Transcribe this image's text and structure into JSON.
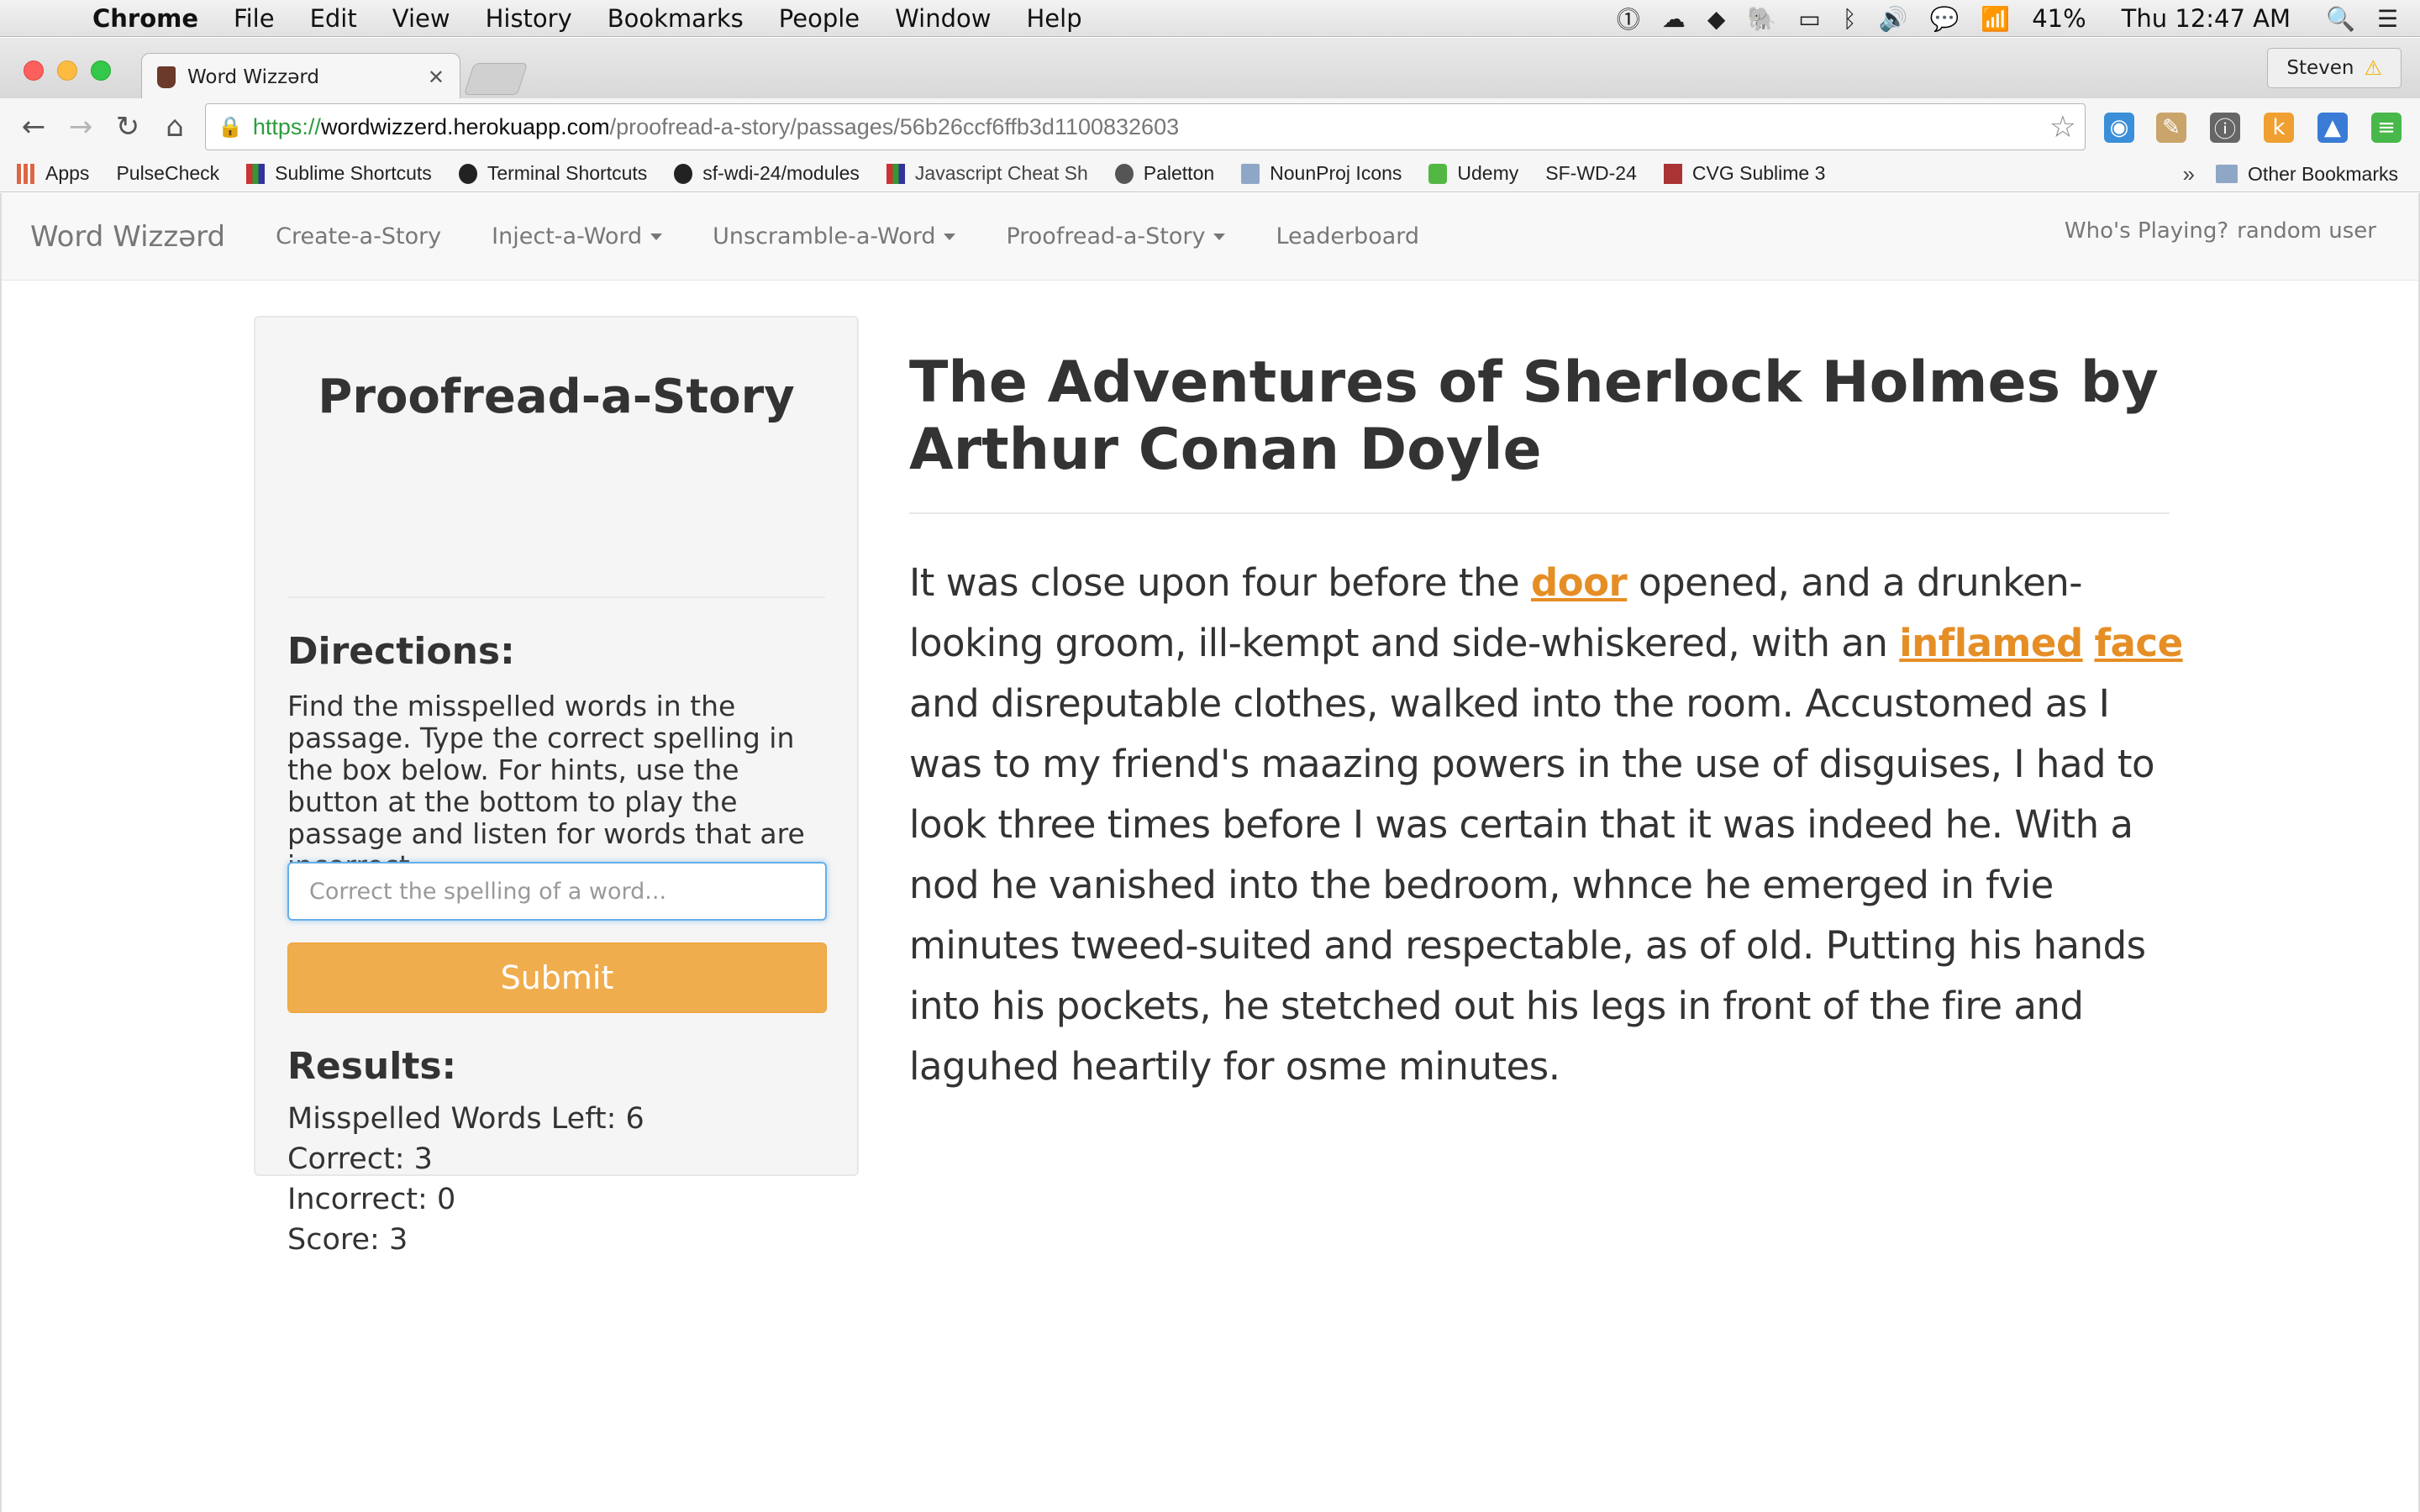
{
  "mac_menu": {
    "app": "Chrome",
    "items": [
      "File",
      "Edit",
      "View",
      "History",
      "Bookmarks",
      "People",
      "Window",
      "Help"
    ],
    "battery": "41%",
    "clock": "Thu 12:47 AM"
  },
  "browser": {
    "tab_title": "Word Wizzərd",
    "profile": "Steven",
    "url_scheme": "https://",
    "url_host": "wordwizzerd.herokuapp.com",
    "url_path": "/proofread-a-story/passages/56b26ccf6ffb3d1100832603",
    "bookmarks": [
      "Apps",
      "PulseCheck",
      "Sublime Shortcuts",
      "Terminal Shortcuts",
      "sf-wdi-24/modules",
      "Javascript Cheat Sh",
      "Paletton",
      "NounProj Icons",
      "Udemy",
      "SF-WD-24",
      "CVG Sublime 3"
    ],
    "bookmarks_more": "»",
    "other_bookmarks": "Other Bookmarks"
  },
  "nav": {
    "brand": "Word Wizzərd",
    "links": [
      "Create-a-Story",
      "Inject-a-Word",
      "Unscramble-a-Word",
      "Proofread-a-Story",
      "Leaderboard"
    ],
    "player_label": "Who's Playing?",
    "player_name": "random user"
  },
  "panel": {
    "title": "Proofread-a-Story",
    "directions_heading": "Directions:",
    "directions_text": "Find the misspelled words in the passage. Type the correct spelling in the box below. For hints, use the button at the bottom to play the passage and listen for words that are incorrect.",
    "input_placeholder": "Correct the spelling of a word...",
    "submit_label": "Submit",
    "results_heading": "Results:",
    "results": {
      "left": "Misspelled Words Left: 6",
      "correct": "Correct: 3",
      "incorrect": "Incorrect: 0",
      "score": "Score: 3"
    }
  },
  "story": {
    "title": "The Adventures of Sherlock Holmes by Arthur Conan Doyle",
    "segments": [
      "It was close upon four before the ",
      "door",
      " opened, and a drunken-looking groom, ill-kempt and side-whiskered, with an ",
      "inflamed",
      " ",
      "face",
      " and disreputable clothes, walked into the room. Accustomed as I was to my friend's maazing powers in the use of disguises, I had to look three times before I was certain that it was indeed he. With a nod he vanished into the bedroom, whnce he emerged in fvie minutes tweed-suited and respectable, as of old. Putting his hands into his pockets, he stetched out his legs in front of the fire and laguhed heartily for osme minutes."
    ]
  },
  "colors": {
    "highlight": "#e58e26",
    "submit": "#f0ad4e",
    "panel_bg": "#f5f5f5",
    "input_focus": "#66afe9"
  }
}
